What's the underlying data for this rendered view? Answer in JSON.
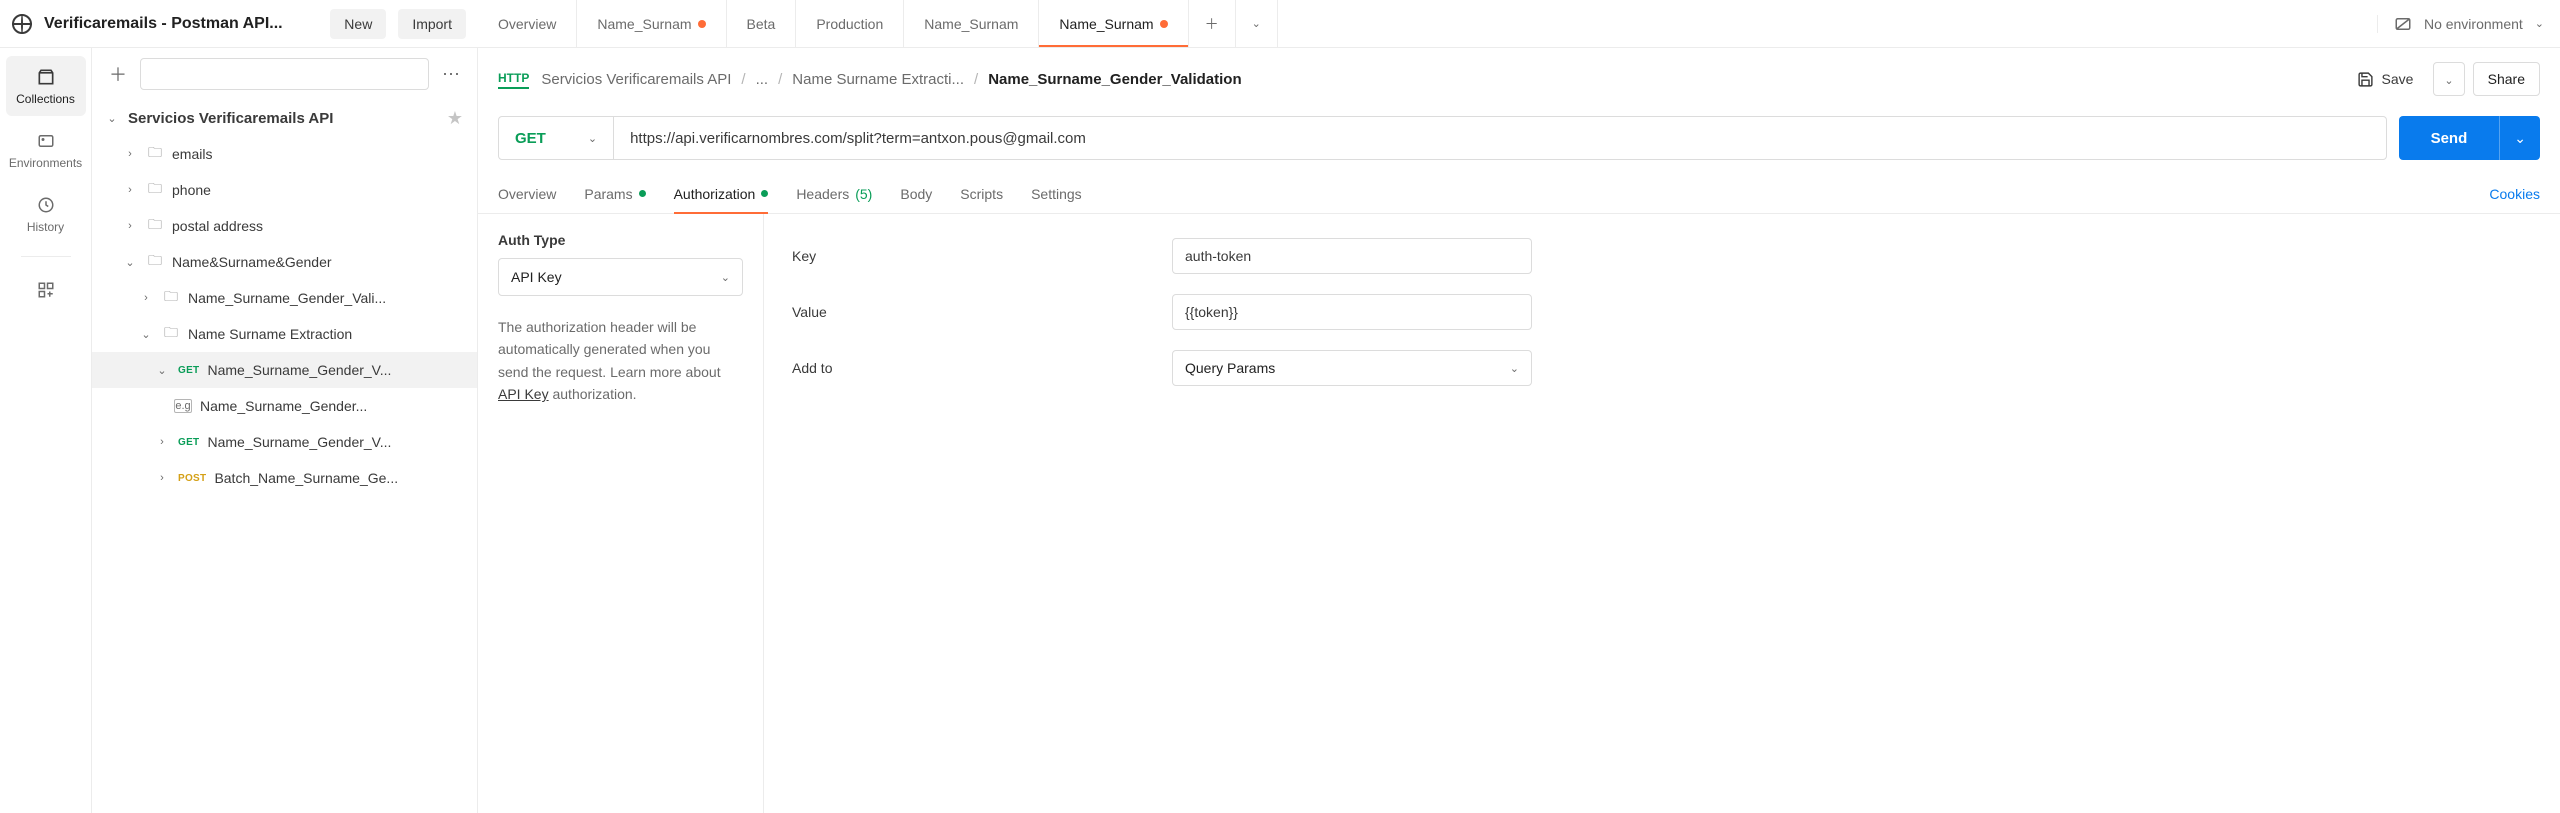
{
  "topbar": {
    "workspace_name": "Verificaremails - Postman API...",
    "new_btn": "New",
    "import_btn": "Import"
  },
  "tabs": [
    {
      "label": "Overview",
      "modified": false,
      "active": false
    },
    {
      "label": "Name_Surnam",
      "modified": true,
      "active": false
    },
    {
      "label": "Beta",
      "modified": false,
      "active": false
    },
    {
      "label": "Production",
      "modified": false,
      "active": false
    },
    {
      "label": "Name_Surnam",
      "modified": false,
      "active": false
    },
    {
      "label": "Name_Surnam",
      "modified": true,
      "active": true
    }
  ],
  "env": {
    "label": "No environment"
  },
  "rail": {
    "collections": "Collections",
    "environments": "Environments",
    "history": "History"
  },
  "sidebar": {
    "root": "Servicios Verificaremails API",
    "items": {
      "emails": "emails",
      "phone": "phone",
      "postal": "postal address",
      "nsg": "Name&Surname&Gender",
      "nsg_vali": "Name_Surname_Gender_Vali...",
      "nse": "Name Surname Extraction",
      "nsg_v": "Name_Surname_Gender_V...",
      "nsg_eg": "Name_Surname_Gender...",
      "nsg_v2": "Name_Surname_Gender_V...",
      "batch": "Batch_Name_Surname_Ge..."
    },
    "methods": {
      "get": "GET",
      "post": "POST"
    }
  },
  "breadcrumb": {
    "root": "Servicios Verificaremails API",
    "dots": "...",
    "parent": "Name Surname Extracti...",
    "current": "Name_Surname_Gender_Validation",
    "save": "Save",
    "share": "Share"
  },
  "request": {
    "method": "GET",
    "url": "https://api.verificarnombres.com/split?term=antxon.pous@gmail.com",
    "send": "Send"
  },
  "sec_tabs": {
    "overview": "Overview",
    "params": "Params",
    "auth": "Authorization",
    "headers": "Headers",
    "headers_count": "(5)",
    "body": "Body",
    "scripts": "Scripts",
    "settings": "Settings",
    "cookies": "Cookies"
  },
  "auth": {
    "type_label": "Auth Type",
    "type_value": "API Key",
    "desc_1": "The authorization header will be automatically generated when you send the request. Learn more about ",
    "desc_link": "API Key",
    "desc_2": " authorization.",
    "key_label": "Key",
    "key_value": "auth-token",
    "value_label": "Value",
    "value_value": "{{token}}",
    "addto_label": "Add to",
    "addto_value": "Query Params"
  }
}
